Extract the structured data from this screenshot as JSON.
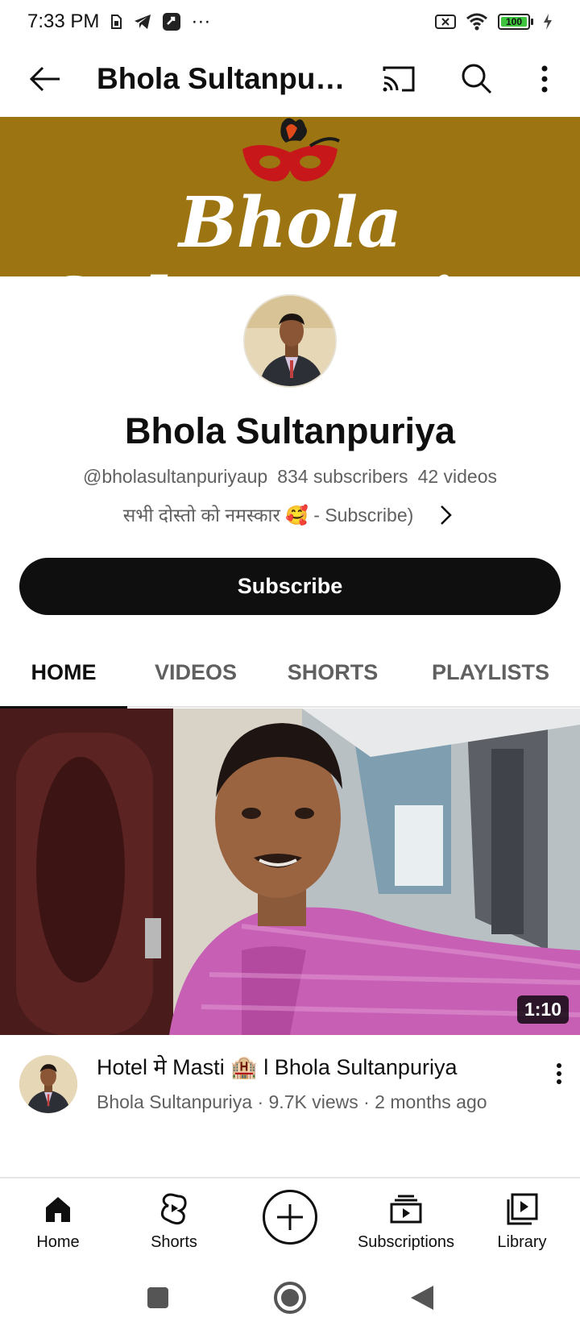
{
  "status_bar": {
    "time": "7:33 PM",
    "dots": "···",
    "battery_level": "100"
  },
  "app_bar": {
    "title": "Bhola Sultanpur..."
  },
  "banner": {
    "text": "Bhola Sultanpuriya",
    "background_color": "#9c7411"
  },
  "channel": {
    "name": "Bhola Sultanpuriya",
    "handle": "@bholasultanpuriyaup",
    "subscribers": "834 subscribers",
    "videos": "42 videos",
    "description": "सभी दोस्तो को नमस्कार 🥰 - Subscribe)",
    "subscribe_label": "Subscribe"
  },
  "tabs": [
    {
      "label": "HOME",
      "active": true
    },
    {
      "label": "VIDEOS",
      "active": false
    },
    {
      "label": "SHORTS",
      "active": false
    },
    {
      "label": "PLAYLISTS",
      "active": false
    }
  ],
  "video": {
    "duration": "1:10",
    "title": "Hotel मे Masti 🏨 l Bhola Sultanpuriya",
    "meta": "Bhola Sultanpuriya · 9.7K views · 2 months ago"
  },
  "bottom_nav": [
    {
      "label": "Home",
      "icon": "home-icon"
    },
    {
      "label": "Shorts",
      "icon": "shorts-icon"
    },
    {
      "label": "",
      "icon": "create-icon"
    },
    {
      "label": "Subscriptions",
      "icon": "subscriptions-icon"
    },
    {
      "label": "Library",
      "icon": "library-icon"
    }
  ],
  "system_nav": [
    "recents-icon",
    "home-circle-icon",
    "back-triangle-icon"
  ]
}
